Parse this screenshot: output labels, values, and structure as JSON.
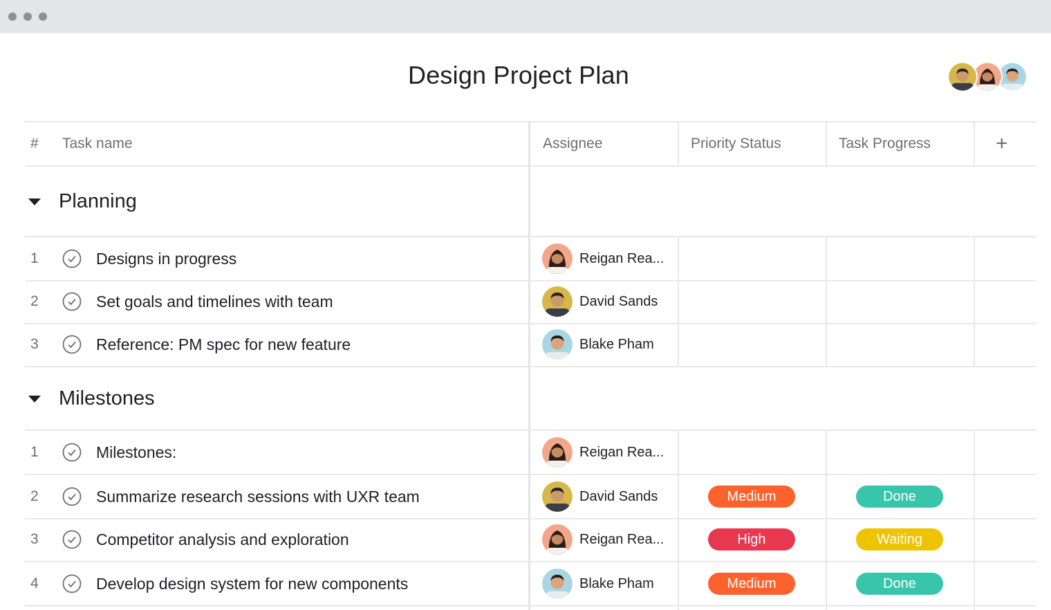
{
  "window": {
    "controls": [
      "close",
      "minimize",
      "zoom"
    ]
  },
  "title": "Design Project Plan",
  "project_members": [
    {
      "name": "David Sands",
      "avatar": "avatar-david"
    },
    {
      "name": "Reigan Rea",
      "avatar": "avatar-reigan"
    },
    {
      "name": "Blake Pham",
      "avatar": "avatar-blake"
    }
  ],
  "columns": {
    "number": "#",
    "task_name": "Task name",
    "assignee": "Assignee",
    "priority": "Priority Status",
    "progress": "Task Progress",
    "add_icon": "plus-icon"
  },
  "colors": {
    "medium": "#fd612c",
    "high": "#e8384f",
    "done": "#37c5ab",
    "waiting": "#eec300"
  },
  "sections": [
    {
      "name": "Planning",
      "tasks": [
        {
          "num": "1",
          "name": "Designs in progress",
          "assignee": "Reigan Rea...",
          "avatar": "avatar-reigan",
          "priority": "",
          "progress": ""
        },
        {
          "num": "2",
          "name": "Set goals and timelines with team",
          "assignee": "David Sands",
          "avatar": "avatar-david",
          "priority": "",
          "progress": ""
        },
        {
          "num": "3",
          "name": "Reference: PM spec for new feature",
          "assignee": "Blake Pham",
          "avatar": "avatar-blake",
          "priority": "",
          "progress": ""
        }
      ]
    },
    {
      "name": "Milestones",
      "tasks": [
        {
          "num": "1",
          "name": "Milestones:",
          "assignee": "Reigan Rea...",
          "avatar": "avatar-reigan",
          "priority": "",
          "progress": ""
        },
        {
          "num": "2",
          "name": "Summarize research sessions with UXR team",
          "assignee": "David Sands",
          "avatar": "avatar-david",
          "priority": "Medium",
          "progress": "Done"
        },
        {
          "num": "3",
          "name": "Competitor analysis and exploration",
          "assignee": "Reigan Rea...",
          "avatar": "avatar-reigan",
          "priority": "High",
          "progress": "Waiting"
        },
        {
          "num": "4",
          "name": "Develop design system for new components",
          "assignee": "Blake Pham",
          "avatar": "avatar-blake",
          "priority": "Medium",
          "progress": "Done"
        }
      ]
    }
  ]
}
